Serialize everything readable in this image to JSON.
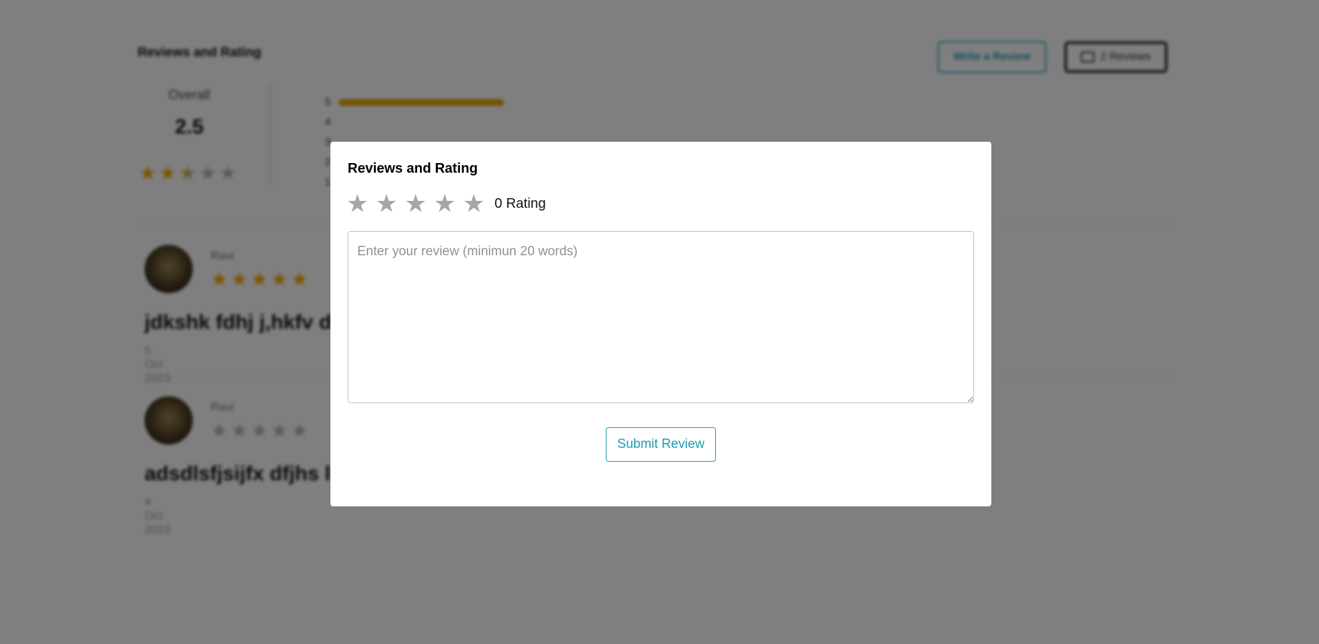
{
  "background": {
    "title": "Reviews and Rating",
    "write_review_label": "Write a Review",
    "reviews_button_label": "2 Reviews",
    "overall": {
      "label": "Overall",
      "value": "2.5",
      "stars_filled": 2.5,
      "stars_total": 5
    },
    "distribution": [
      {
        "label": "5",
        "fraction": 1.0
      },
      {
        "label": "4",
        "fraction": 0
      },
      {
        "label": "3",
        "fraction": 0
      },
      {
        "label": "2",
        "fraction": 0
      },
      {
        "label": "1",
        "fraction": 0
      }
    ],
    "reviews": [
      {
        "name": "Ravi",
        "stars": 5,
        "text": "jdkshk fdhj j,hkfv d",
        "date": "5 Oct 2023"
      },
      {
        "name": "Ravi",
        "stars": 0,
        "text": "adsdlsfjsijfx dfjhs l",
        "date": "4 Oct 2023"
      }
    ]
  },
  "modal": {
    "title": "Reviews and Rating",
    "rating_text": "0 Rating",
    "star_count": 5,
    "selected_stars": 0,
    "textarea_placeholder": "Enter your review (minimun 20 words)",
    "textarea_value": "",
    "submit_label": "Submit Review"
  },
  "colors": {
    "accent": "#1c9bb3",
    "star_filled": "#f5a800",
    "star_empty": "#a6a6a6",
    "overlay": "rgba(0,0,0,0.5)"
  }
}
